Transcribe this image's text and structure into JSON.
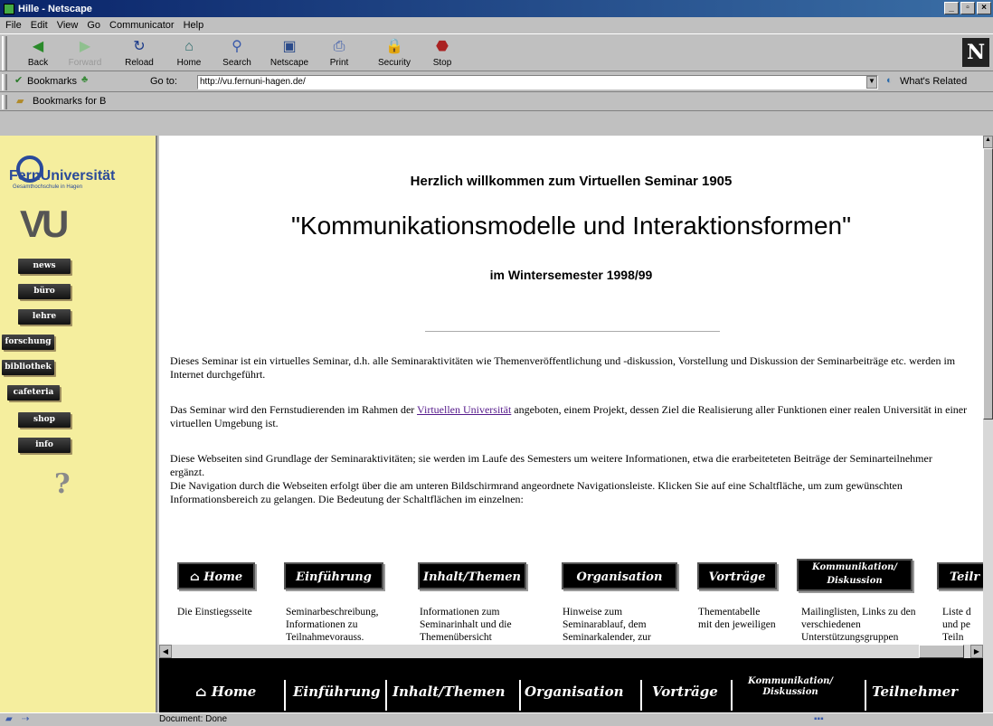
{
  "window": {
    "title": "Hille - Netscape"
  },
  "menu": [
    "File",
    "Edit",
    "View",
    "Go",
    "Communicator",
    "Help"
  ],
  "toolbar": [
    {
      "label": "Back",
      "icon": "back-arrow-icon"
    },
    {
      "label": "Forward",
      "icon": "forward-arrow-icon",
      "disabled": true
    },
    {
      "label": "Reload",
      "icon": "reload-icon"
    },
    {
      "label": "Home",
      "icon": "home-icon"
    },
    {
      "label": "Search",
      "icon": "search-icon"
    },
    {
      "label": "Netscape",
      "icon": "netscape-icon"
    },
    {
      "label": "Print",
      "icon": "print-icon"
    },
    {
      "label": "Security",
      "icon": "security-icon"
    },
    {
      "label": "Stop",
      "icon": "stop-icon"
    }
  ],
  "location": {
    "bookmarks": "Bookmarks",
    "goto": "Go to:",
    "url": "http://vu.fernuni-hagen.de/",
    "related": "What's Related"
  },
  "personal": {
    "bookmarks_for": "Bookmarks for B"
  },
  "sidebar": {
    "logo_name": "FernUniversität",
    "logo_sub": "Gesamthochschule in Hagen",
    "vu": "VU",
    "items": [
      "news",
      "büro",
      "lehre",
      "forschung",
      "bibliothek",
      "cafeteria",
      "shop",
      "info"
    ],
    "help": "?"
  },
  "main": {
    "welcome": "Herzlich willkommen zum Virtuellen Seminar 1905",
    "title": "\"Kommunikationsmodelle und Interaktionsformen\"",
    "semester": "im Wintersemester 1998/99",
    "p1": "Dieses Seminar ist ein virtuelles Seminar, d.h. alle Seminaraktivitäten wie Themenveröffentlichung und -diskussion, Vorstellung und Diskussion der Seminarbeiträge etc. werden im Internet durchgeführt.",
    "p2_a": "Das Seminar wird den Fernstudierenden im Rahmen der ",
    "p2_link": "Virtuellen Universität",
    "p2_b": " angeboten, einem Projekt, dessen Ziel die Realisierung aller Funktionen einer realen Universität in einer virtuellen Umgebung ist.",
    "p3": "Diese Webseiten sind Grundlage der Seminaraktivitäten; sie werden im Laufe des Semesters um weitere Informationen, etwa die erarbeiteteten Beiträge der Seminarteilnehmer ergänzt.",
    "p4": "Die Navigation durch die Webseiten erfolgt über die am unteren Bildschirmrand angeordnete Navigationsleiste. Klicken Sie auf eine Schaltfläche, um zum gewünschten Informationsbereich zu gelangen. Die Bedeutung der Schaltflächen im einzelnen:",
    "nav": [
      {
        "label": "Home",
        "desc": "Die Einstiegsseite"
      },
      {
        "label": "Einführung",
        "desc": "Seminarbeschreibung, Informationen zu Teilnahmevorauss."
      },
      {
        "label": "Inhalt/Themen",
        "desc": "Informationen zum Seminarinhalt und die Themenübersicht"
      },
      {
        "label": "Organisation",
        "desc": "Hinweise zum Seminarablauf, dem Seminarkalender, zur"
      },
      {
        "label": "Vorträge",
        "desc": "Thementabelle mit den jeweiligen"
      },
      {
        "label": "Kommunikation/ Diskussion",
        "desc": "Mailinglisten, Links zu den verschiedenen Unterstützungsgruppen"
      },
      {
        "label": "Teilr",
        "desc": "Liste d und pe Teiln"
      }
    ]
  },
  "bottom_nav": [
    "Home",
    "Einführung",
    "Inhalt/Themen",
    "Organisation",
    "Vorträge",
    "Kommunikation/ Diskussion",
    "Teilnehmer"
  ],
  "status": {
    "text": "Document: Done"
  }
}
